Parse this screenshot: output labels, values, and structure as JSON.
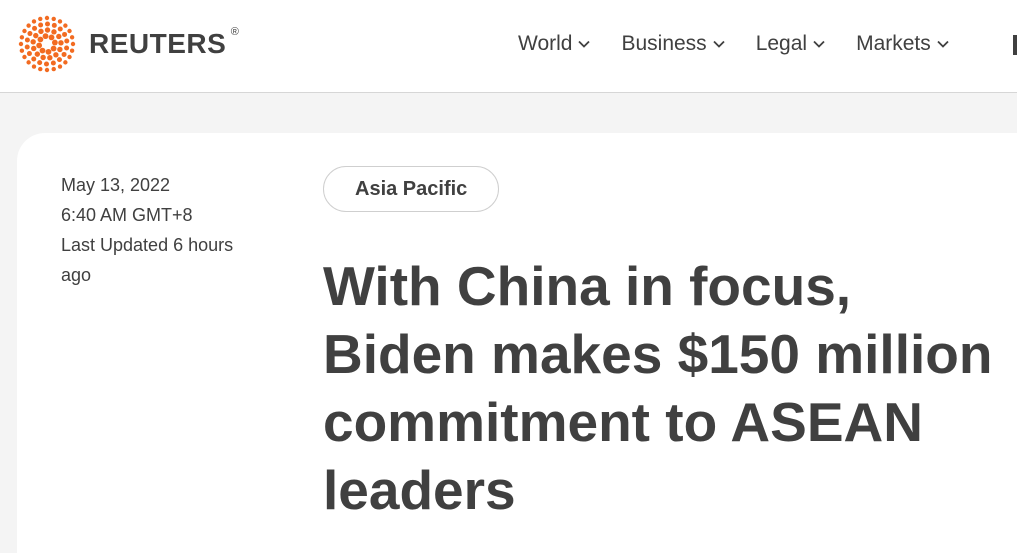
{
  "header": {
    "logo_text": "REUTERS",
    "logo_reg": "®",
    "logo_icon": "reuters-dot-logo-icon",
    "brand_color": "#f26b21",
    "nav": [
      {
        "label": "World",
        "icon": "chevron-down-icon"
      },
      {
        "label": "Business",
        "icon": "chevron-down-icon"
      },
      {
        "label": "Legal",
        "icon": "chevron-down-icon"
      },
      {
        "label": "Markets",
        "icon": "chevron-down-icon"
      }
    ]
  },
  "article": {
    "date": "May 13, 2022",
    "time": "6:40 AM GMT+8",
    "updated": "Last Updated 6 hours ago",
    "section_tag": "Asia Pacific",
    "headline": "With China in focus, Biden makes $150 million commitment to ASEAN leaders"
  }
}
